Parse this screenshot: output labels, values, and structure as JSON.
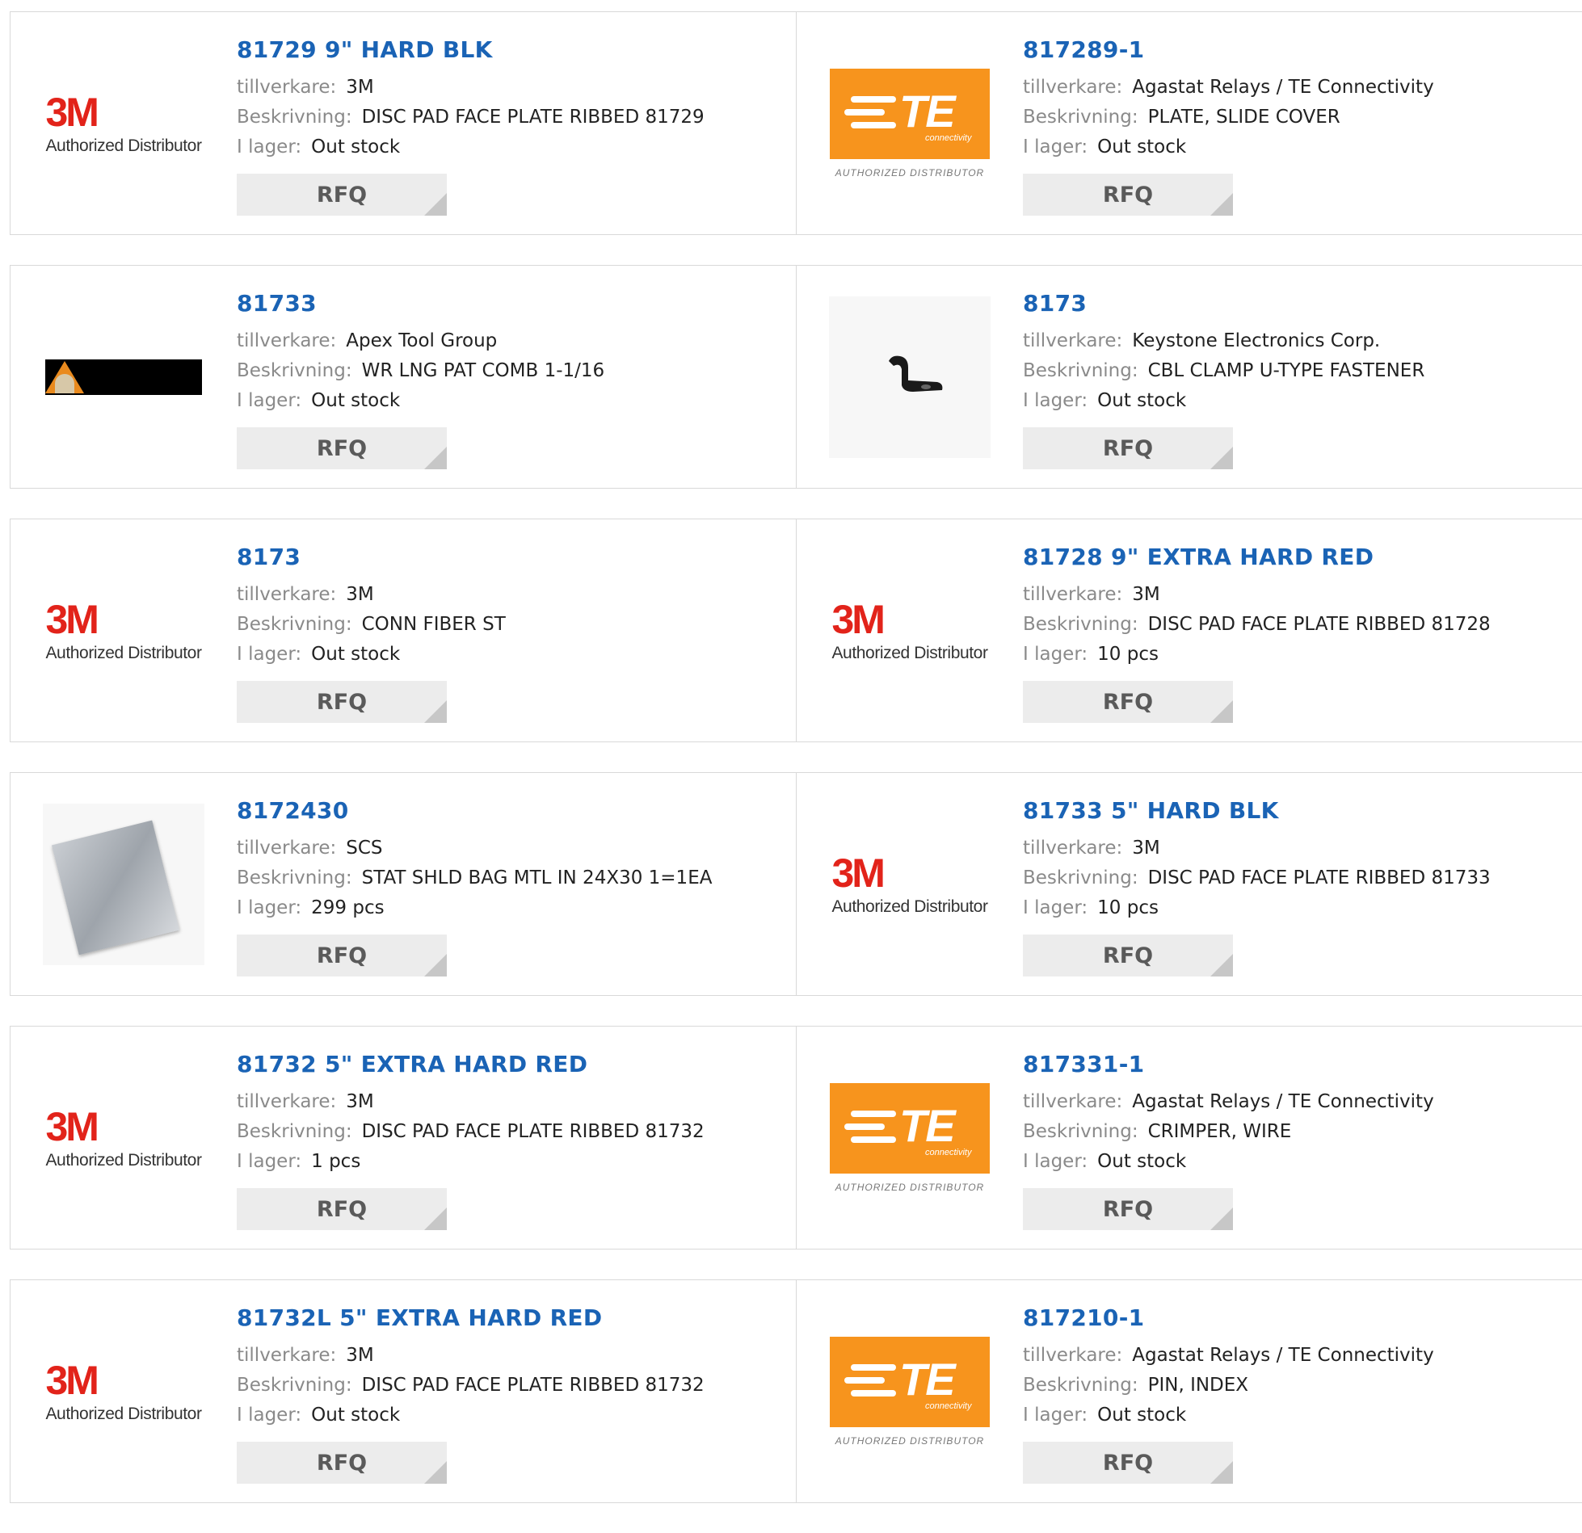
{
  "labels": {
    "manufacturer": "tillverkare:",
    "description": "Beskrivning:",
    "stock": "I lager:",
    "rfq": "RFQ"
  },
  "logos": {
    "3m_mark": "3M",
    "3m_sub": "Authorized Distributor",
    "te_mark": "TE",
    "te_sub": "connectivity",
    "te_auth": "AUTHORIZED DISTRIBUTOR"
  },
  "products": [
    {
      "title": "81729 9\" HARD BLK",
      "manufacturer": "3M",
      "description": "DISC PAD FACE PLATE RIBBED 81729",
      "stock": "Out stock",
      "logo": "3m-logo"
    },
    {
      "title": "817289-1",
      "manufacturer": "Agastat Relays / TE Connectivity",
      "description": "PLATE, SLIDE COVER",
      "stock": "Out stock",
      "logo": "te-logo"
    },
    {
      "title": "81733",
      "manufacturer": "Apex Tool Group",
      "description": "WR LNG PAT COMB 1-1/16",
      "stock": "Out stock",
      "logo": "apex-logo"
    },
    {
      "title": "8173",
      "manufacturer": "Keystone Electronics Corp.",
      "description": "CBL CLAMP U-TYPE FASTENER",
      "stock": "Out stock",
      "logo": "cable-clamp-photo"
    },
    {
      "title": "8173",
      "manufacturer": "3M",
      "description": "CONN FIBER ST",
      "stock": "Out stock",
      "logo": "3m-logo"
    },
    {
      "title": "81728 9\" EXTRA HARD RED",
      "manufacturer": "3M",
      "description": "DISC PAD FACE PLATE RIBBED 81728",
      "stock": "10 pcs",
      "logo": "3m-logo"
    },
    {
      "title": "8172430",
      "manufacturer": "SCS",
      "description": "STAT SHLD BAG MTL IN 24X30 1=1EA",
      "stock": "299 pcs",
      "logo": "static-bag-photo"
    },
    {
      "title": "81733 5\" HARD BLK",
      "manufacturer": "3M",
      "description": "DISC PAD FACE PLATE RIBBED 81733",
      "stock": "10 pcs",
      "logo": "3m-logo"
    },
    {
      "title": "81732 5\" EXTRA HARD RED",
      "manufacturer": "3M",
      "description": "DISC PAD FACE PLATE RIBBED 81732",
      "stock": "1 pcs",
      "logo": "3m-logo"
    },
    {
      "title": "817331-1",
      "manufacturer": "Agastat Relays / TE Connectivity",
      "description": "CRIMPER, WIRE",
      "stock": "Out stock",
      "logo": "te-logo"
    },
    {
      "title": "81732L 5\" EXTRA HARD RED",
      "manufacturer": "3M",
      "description": "DISC PAD FACE PLATE RIBBED 81732",
      "stock": "Out stock",
      "logo": "3m-logo"
    },
    {
      "title": "817210-1",
      "manufacturer": "Agastat Relays / TE Connectivity",
      "description": "PIN, INDEX",
      "stock": "Out stock",
      "logo": "te-logo"
    }
  ],
  "colors": {
    "title": "#1a63b5",
    "label": "#8a8a8a",
    "rfq_bg": "#ececec",
    "te_orange": "#f7941d",
    "brand_3m": "#e2231a"
  }
}
